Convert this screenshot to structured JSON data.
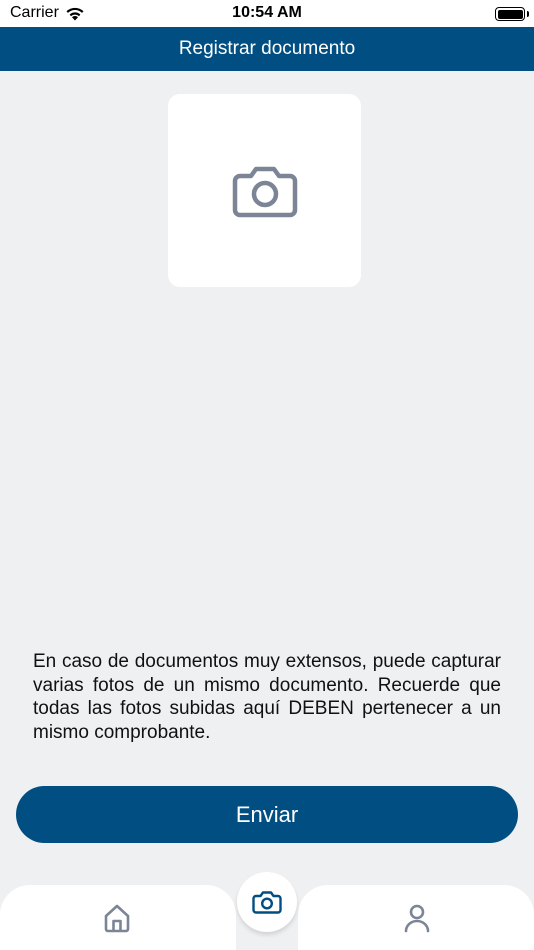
{
  "status_bar": {
    "carrier": "Carrier",
    "time": "10:54 AM"
  },
  "nav": {
    "title": "Registrar documento"
  },
  "photo_placeholder": {
    "icon": "camera-icon"
  },
  "description": "En caso de documentos muy extensos, puede capturar varias fotos de un mismo documento. Recuerde que todas las fotos subidas aquí DEBEN pertenecer a un mismo comprobante.",
  "actions": {
    "send_label": "Enviar"
  },
  "tab_bar": {
    "items": [
      {
        "icon": "home-icon"
      },
      {
        "icon": "camera-icon"
      },
      {
        "icon": "user-icon"
      }
    ]
  },
  "colors": {
    "primary": "#004e82",
    "background": "#eff0f2",
    "icon_gray": "#7c8595"
  }
}
